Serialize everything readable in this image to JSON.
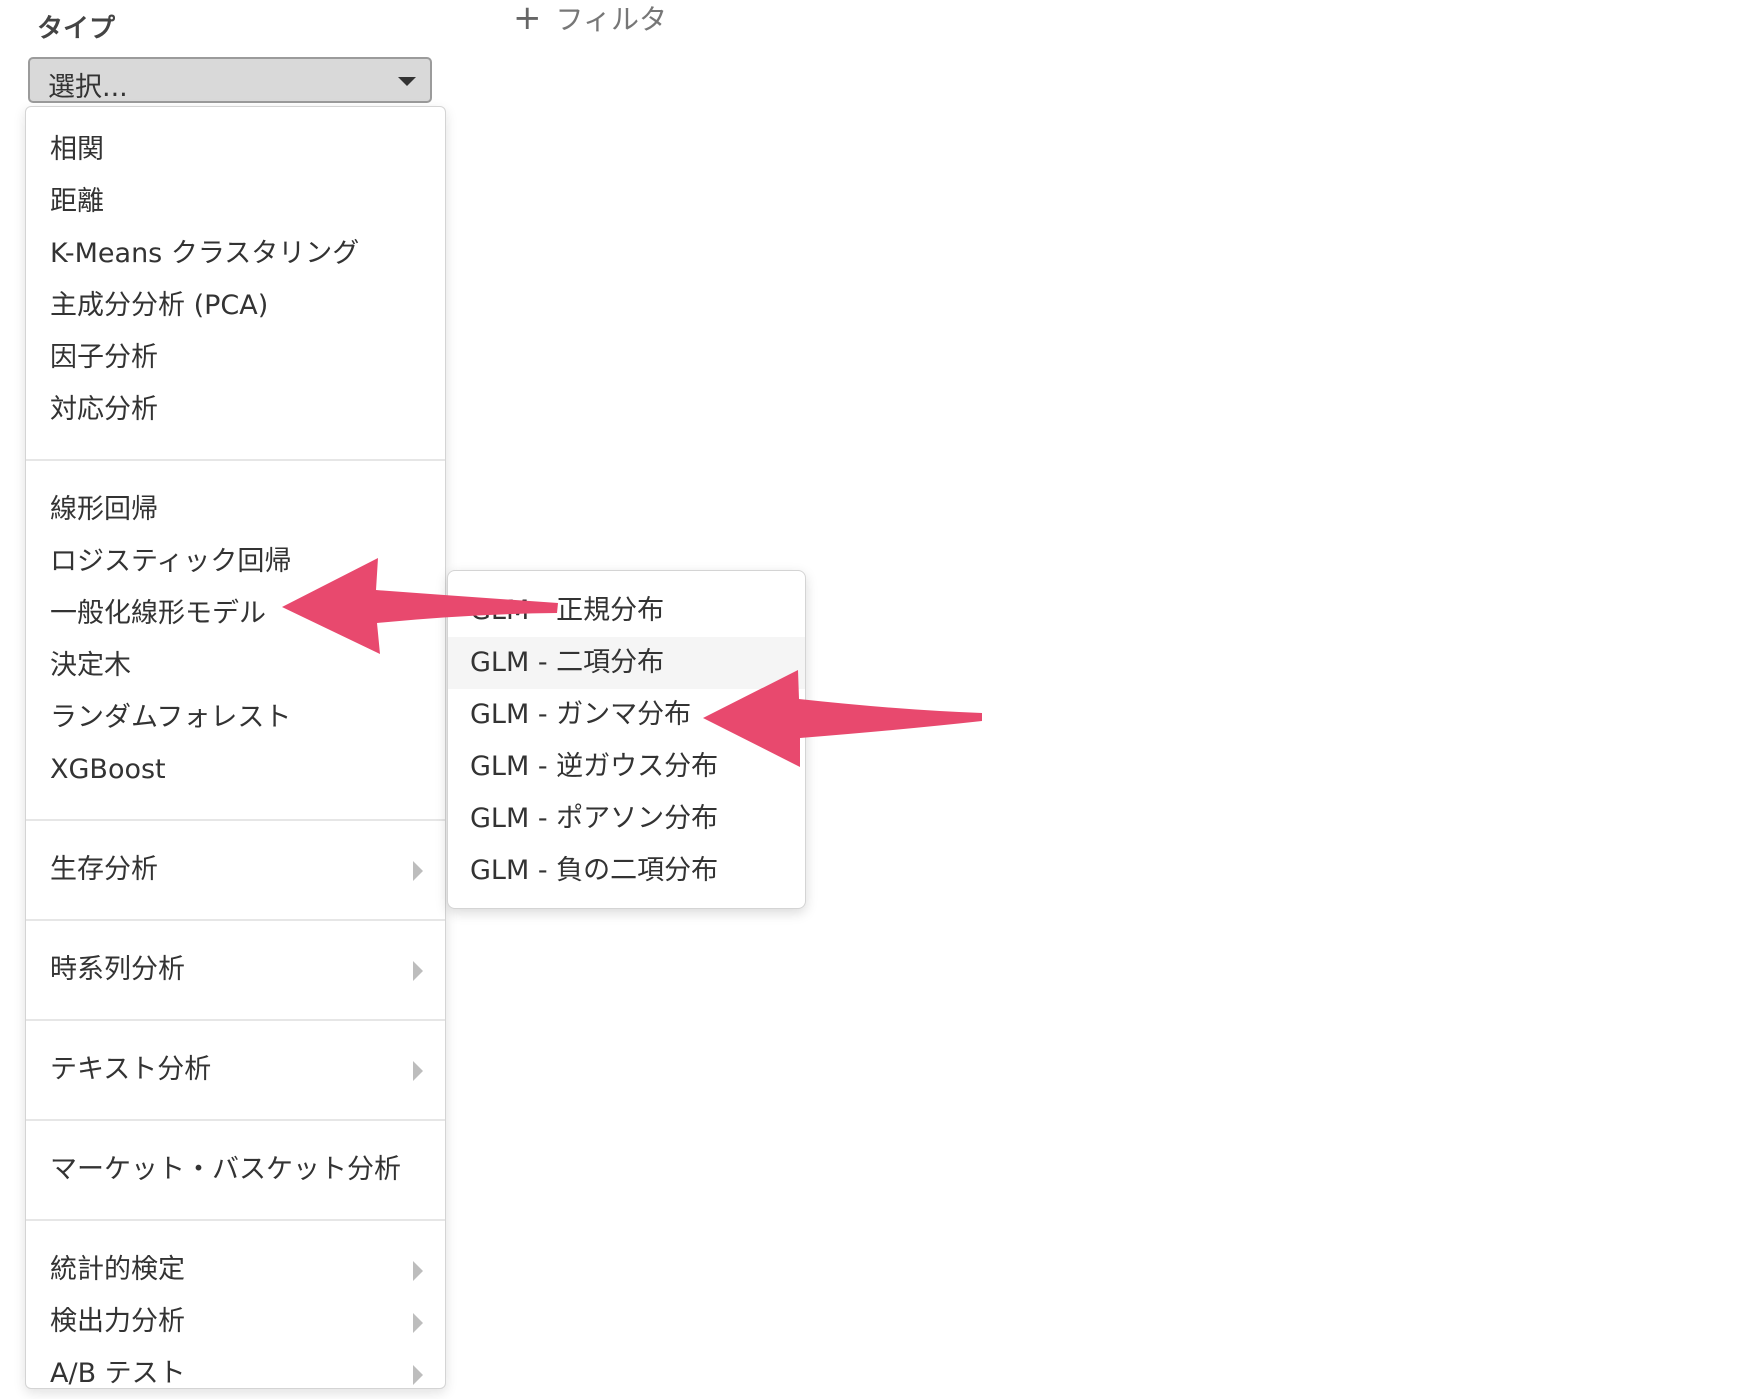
{
  "header": {
    "type_label": "タイプ",
    "filter_label": "フィルタ",
    "filter_icon": "plus-icon"
  },
  "select": {
    "value": "選択...",
    "caret_icon": "caret-down-icon"
  },
  "menu": {
    "groups": [
      {
        "items": [
          {
            "label": "相関"
          },
          {
            "label": "距離"
          },
          {
            "label": "K-Means クラスタリング"
          },
          {
            "label": "主成分分析 (PCA)"
          },
          {
            "label": "因子分析"
          },
          {
            "label": "対応分析"
          }
        ]
      },
      {
        "items": [
          {
            "label": "線形回帰"
          },
          {
            "label": "ロジスティック回帰"
          },
          {
            "label": "一般化線形モデル"
          },
          {
            "label": "決定木"
          },
          {
            "label": "ランダムフォレスト"
          },
          {
            "label": "XGBoost"
          }
        ]
      },
      {
        "items": [
          {
            "label": "生存分析",
            "has_submenu": true
          }
        ]
      },
      {
        "items": [
          {
            "label": "時系列分析",
            "has_submenu": true
          }
        ]
      },
      {
        "items": [
          {
            "label": "テキスト分析",
            "has_submenu": true
          }
        ]
      },
      {
        "items": [
          {
            "label": "マーケット・バスケット分析"
          }
        ]
      },
      {
        "items": [
          {
            "label": "統計的検定",
            "has_submenu": true
          },
          {
            "label": "検出力分析",
            "has_submenu": true
          },
          {
            "label": "A/B テスト",
            "has_submenu": true
          }
        ]
      }
    ]
  },
  "submenu": {
    "parent": "一般化線形モデル",
    "items": [
      {
        "label": "GLM - 正規分布"
      },
      {
        "label": "GLM - 二項分布",
        "highlighted": true
      },
      {
        "label": "GLM - ガンマ分布"
      },
      {
        "label": "GLM - 逆ガウス分布"
      },
      {
        "label": "GLM - ポアソン分布"
      },
      {
        "label": "GLM - 負の二項分布"
      }
    ]
  },
  "annotations": {
    "arrow_color": "#E8496E",
    "arrows": [
      {
        "points_to": "一般化線形モデル"
      },
      {
        "points_to": "GLM - ガンマ分布"
      }
    ]
  }
}
